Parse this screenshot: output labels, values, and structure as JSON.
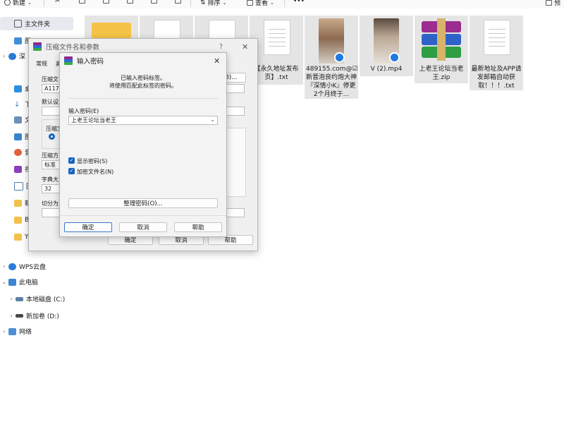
{
  "toolbar": {
    "new_label": "新建",
    "sort_label": "排序",
    "view_label": "查看",
    "more_label": "•••",
    "preview_label": "预"
  },
  "sidebar": {
    "items": [
      {
        "label": "主文件夹"
      },
      {
        "label": "图"
      },
      {
        "label": "深"
      },
      {
        "label": "桌"
      },
      {
        "label": "下"
      },
      {
        "label": "文"
      },
      {
        "label": "图"
      },
      {
        "label": "音"
      },
      {
        "label": "视"
      },
      {
        "label": "回"
      },
      {
        "label": "新"
      },
      {
        "label": "Ba"
      },
      {
        "label": "YS"
      },
      {
        "label": "WPS云盘"
      },
      {
        "label": "此电脑"
      },
      {
        "label": "本地磁盘 (C:)"
      },
      {
        "label": "新加卷 (D:)"
      },
      {
        "label": "网络"
      }
    ]
  },
  "files": [
    {
      "label": "【永久地址发布页】.txt"
    },
    {
      "label": "489155.com@☑新晋泡良约炮大神『深情小K』停更2个月终于..."
    },
    {
      "label": "V (2).mp4"
    },
    {
      "label": "上老王论坛当老王.zip"
    },
    {
      "label": "最新地址及APP请发邮箱自动获取！！！.txt"
    }
  ],
  "rar_dialog": {
    "title": "压缩文件名和参数",
    "help_char": "?",
    "tab_general": "常规",
    "tab_second": "高",
    "archive_name_label": "压缩文",
    "archive_name_value": "A117",
    "browse_label": "(B)...",
    "default_profile_label": "默认设置",
    "format_label": "压缩文",
    "method_label": "压缩方",
    "method_value": "标准",
    "dict_label": "字典大",
    "dict_value": "32",
    "split_label": "切分为",
    "ok": "确定",
    "cancel": "取消",
    "help": "帮助"
  },
  "pwd_dialog": {
    "title": "输入密码",
    "message_line1": "已输入密码标签。",
    "message_line2": "将使用匹配此标签的密码。",
    "password_label": "输入密码(E)",
    "password_value": "上老王论坛当老王",
    "show_password_label": "显示密码(S)",
    "show_password_checked": true,
    "encrypt_names_label": "加密文件名(N)",
    "encrypt_names_checked": true,
    "organize_label": "整理密码(O)...",
    "ok": "确定",
    "cancel": "取消",
    "help": "帮助"
  },
  "colors": {
    "accent": "#1565c0",
    "sidebar_selected": "#e6eaf0",
    "tile_bg": "#e5e5e5"
  }
}
